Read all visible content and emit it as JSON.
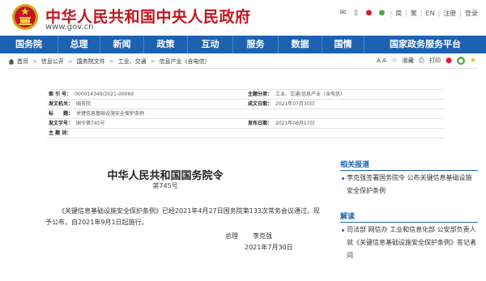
{
  "header": {
    "site_title": "中华人民共和国中央人民政府",
    "site_domain": "www.gov.cn",
    "topbar": {
      "lang_zh": "简",
      "lang_tw": "繁",
      "lang_en": "EN",
      "login": "登录",
      "register": "注册"
    }
  },
  "nav": {
    "items": [
      "国务院",
      "总理",
      "新闻",
      "政策",
      "互动",
      "服务",
      "数据",
      "国情",
      "国家政务服务平台"
    ]
  },
  "breadcrumb": {
    "items": [
      "首页",
      "信息公开",
      "国务院文件",
      "工业、交通",
      "信息产业（含电信）"
    ],
    "font_tools": "A A",
    "favorite": "收藏",
    "print": "打印"
  },
  "info": {
    "index_label": "索 引 号：",
    "index_value": "000014349/2021-00069",
    "theme_label": "主题分类：",
    "theme_value": "工业、交通\\信息产业（含电信）",
    "issuer_label": "发文机关：",
    "issuer_value": "国务院",
    "created_label": "成文日期：",
    "created_value": "2021年07月30日",
    "title_label": "标　　题：",
    "title_value": "关键信息基础设施安全保护条例",
    "number_label": "发文字号：",
    "number_value": "国令第745号",
    "published_label": "发布日期：",
    "published_value": "2021年08月17日",
    "keywords_label": "主 题 词：",
    "keywords_value": ""
  },
  "document": {
    "title": "中华人民共和国国务院令",
    "number": "第745号",
    "body": "《关键信息基础设施安全保护条例》已经2021年4月27日国务院第133次常务会议通过，现予公布，自2021年9月1日起施行。",
    "sign_role": "总理",
    "sign_name": "李克强",
    "sign_date": "2021年7月30日"
  },
  "sidebar": {
    "related_title": "相关报道",
    "related_items": [
      "李克强签署国务院令 公布关键信息基础设施安全保护条例"
    ],
    "interpret_title": "解读",
    "interpret_items": [
      "司法部 网信办 工业和信息化部 公安部负责人就《关键信息基础设施安全保护条例》答记者问"
    ]
  },
  "colors": {
    "brand_red": "#c4161c",
    "nav_blue": "#1d62b1"
  }
}
